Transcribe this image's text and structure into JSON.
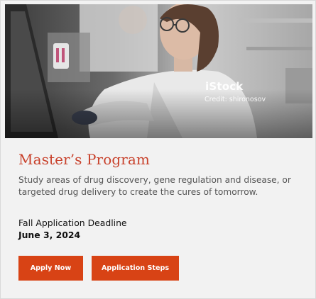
{
  "hero_image": {
    "alt": "Scientist in a lab coat working at a computer in a laboratory",
    "watermark_logo": "iStock",
    "watermark_credit": "Credit: shironosov"
  },
  "program": {
    "title": "Master’s Program",
    "description": "Study areas of drug discovery, gene regulation and disease, or targeted drug delivery to create the cures of tomorrow."
  },
  "deadline": {
    "label": "Fall Application Deadline",
    "date": "June 3, 2024"
  },
  "buttons": {
    "apply_label": "Apply Now",
    "steps_label": "Application Steps"
  },
  "colors": {
    "accent": "#c8412b",
    "button_bg": "#d84315",
    "card_bg": "#f2f2f2"
  }
}
